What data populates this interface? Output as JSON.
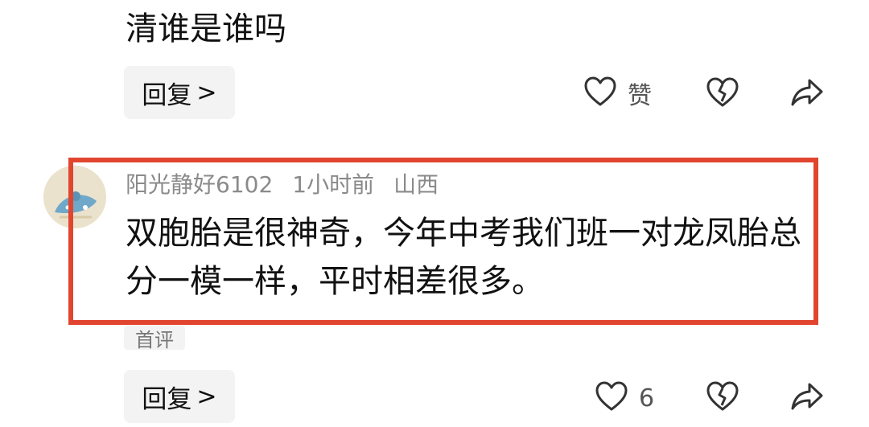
{
  "previous_comment": {
    "text_tail": "清谁是谁吗",
    "reply_label": "回复",
    "reply_chevron": ">",
    "like_label": "赞"
  },
  "comment": {
    "username": "阳光静好6102",
    "time": "1小时前",
    "location": "山西",
    "body": "双胞胎是很神奇，今年中考我们班一对龙凤胎总分一模一样，平时相差很多。",
    "tag": "首评",
    "reply_label": "回复",
    "reply_chevron": ">",
    "like_count": "6"
  },
  "colors": {
    "highlight_border": "#e2452f",
    "button_bg": "#f3f3f3",
    "meta_text": "#8a8a8a"
  },
  "icons": [
    "heart-icon",
    "broken-heart-icon",
    "share-arrow-icon"
  ]
}
